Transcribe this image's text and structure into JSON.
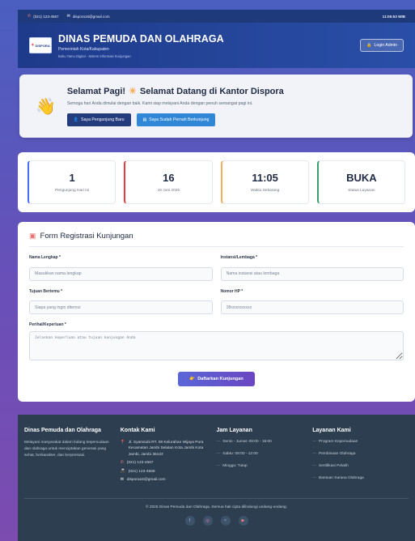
{
  "topbar": {
    "phone_icon": "phone-icon",
    "phone": "(021) 123-4567",
    "email_icon": "mail-icon",
    "email": "dispora16@gmail.com",
    "time": "11:05:53 WIB"
  },
  "header": {
    "logo_text": "DISPORA",
    "title": "DINAS PEMUDA DAN OLAHRAGA",
    "subtitle": "Pemerintah Kota/Kabupaten",
    "tagline": "Buku Tamu Digital - Sistem Informasi Kunjungan",
    "login_label": "Login Admin"
  },
  "welcome": {
    "title_left": "Selamat Pagi!",
    "title_right": "Selamat Datang di Kantor Dispora",
    "description": "Semoga hari Anda dimulai dengan baik. Kami siap melayani Anda dengan penuh semangat pagi ini.",
    "btn_new": "Saya Pengunjung Baru",
    "btn_returning": "Saya Sudah Pernah Berkunjung"
  },
  "stats": [
    {
      "value": "1",
      "label": "Pengunjung Hari Ini",
      "color": "#4a6cf7"
    },
    {
      "value": "16",
      "label": "16 Juni 2025",
      "color": "#e53e3e"
    },
    {
      "value": "11:05",
      "label": "Waktu Sekarang",
      "color": "#f6ad55"
    },
    {
      "value": "BUKA",
      "label": "Status Layanan",
      "color": "#38a169"
    }
  ],
  "form": {
    "title": "Form Registrasi Kunjungan",
    "nama_label": "Nama Lengkap *",
    "nama_placeholder": "Masukkan nama lengkap",
    "instansi_label": "Instansi/Lembaga *",
    "instansi_placeholder": "Nama instansi atau lembaga",
    "tujuan_label": "Tujuan Bertemu *",
    "tujuan_placeholder": "Siapa yang ingin ditemui",
    "hp_label": "Nomor HP *",
    "hp_placeholder": "08xxxxxxxxxx",
    "perihal_label": "Perihal/Keperluan *",
    "perihal_placeholder": "Jelaskan keperluan atau tujuan kunjungan Anda",
    "submit_label": "Daftarkan Kunjungan"
  },
  "footer": {
    "about_title": "Dinas Pemuda dan Olahraga",
    "about_text": "Melayani masyarakat dalam bidang kepemudaan dan olahraga untuk menciptakan generasi yang sehat, berkarakter, dan berprestasi.",
    "contact_title": "Kontak Kami",
    "address": "Jl. Syamsubi RT. 08 Kelurahan Wijaya Pura Kecamatan Jambi Selatan Kota Jambi Kota Jambi, Jambi 36122",
    "phone": "(021) 123-4567",
    "fax": "(021) 123-4568",
    "email": "dispora16@gmail.com",
    "hours_title": "Jam Layanan",
    "hours": [
      "Senin - Jumat: 08:00 - 16:00",
      "Sabtu: 08:00 - 12:00",
      "Minggu: Tutup"
    ],
    "services_title": "Layanan Kami",
    "services": [
      "Program Kepemudaan",
      "Pembinaan Olahraga",
      "Sertifikasi Pelatih",
      "Bantuan Sarana Olahraga"
    ],
    "copyright": "© 2025 Dinas Pemuda dan Olahraga. Semua hak cipta dilindungi undang-undang.",
    "socials": [
      "facebook-icon",
      "instagram-icon",
      "twitter-icon",
      "youtube-icon"
    ]
  }
}
